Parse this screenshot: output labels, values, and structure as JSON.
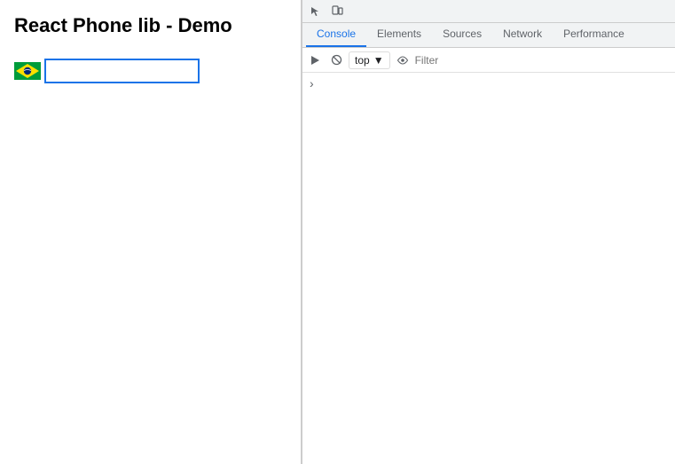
{
  "page": {
    "title": "React Phone lib - Demo"
  },
  "phone_input": {
    "placeholder": "",
    "value": ""
  },
  "devtools": {
    "tabs": [
      {
        "label": "Console",
        "active": true
      },
      {
        "label": "Elements",
        "active": false
      },
      {
        "label": "Sources",
        "active": false
      },
      {
        "label": "Network",
        "active": false
      },
      {
        "label": "Performance",
        "active": false
      }
    ],
    "context_selector": {
      "value": "top",
      "arrow": "▼"
    },
    "filter": {
      "placeholder": "Filter"
    },
    "console_arrow": "›"
  }
}
